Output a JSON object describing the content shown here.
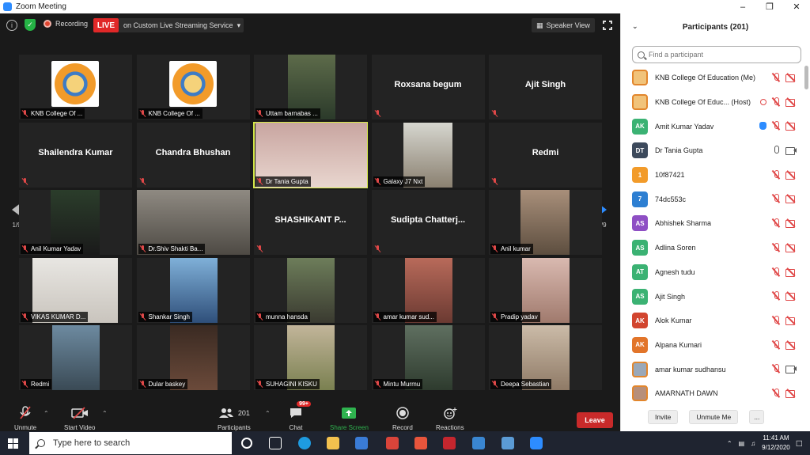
{
  "window": {
    "title": "Zoom Meeting"
  },
  "topbar": {
    "recording_label": "Recording",
    "live_label": "LIVE",
    "stream_label": "on Custom Live Streaming Service",
    "view_label": "Speaker View"
  },
  "grid": {
    "page_left": "1/9",
    "page_right": "1/9",
    "tiles": [
      {
        "name": "KNB College Of ...",
        "kind": "logo"
      },
      {
        "name": "KNB College Of ...",
        "kind": "logo"
      },
      {
        "name": "Uttam barnabas ...",
        "kind": "video"
      },
      {
        "name": "Roxsana begum",
        "kind": "name"
      },
      {
        "name": "Ajit Singh",
        "kind": "name"
      },
      {
        "name": "Shailendra Kumar",
        "kind": "name"
      },
      {
        "name": "Chandra Bhushan",
        "kind": "name"
      },
      {
        "name": "Dr Tania Gupta",
        "kind": "video",
        "active": true
      },
      {
        "name": "Galaxy J7 Nxt",
        "kind": "video"
      },
      {
        "name": "Redmi",
        "kind": "name"
      },
      {
        "name": "Anil Kumar Yadav",
        "kind": "video"
      },
      {
        "name": "Dr.Shiv Shakti Ba...",
        "kind": "video"
      },
      {
        "name": "SHASHIKANT P...",
        "kind": "name"
      },
      {
        "name": "Sudipta Chatterj...",
        "kind": "name"
      },
      {
        "name": "Anil kumar",
        "kind": "video"
      },
      {
        "name": "VIKAS KUMAR D...",
        "kind": "video"
      },
      {
        "name": "Shankar Singh",
        "kind": "video"
      },
      {
        "name": "munna hansda",
        "kind": "video"
      },
      {
        "name": "amar kumar sud...",
        "kind": "video"
      },
      {
        "name": "Pradip yadav",
        "kind": "video"
      },
      {
        "name": "Redmi",
        "kind": "video"
      },
      {
        "name": "Dular baskey",
        "kind": "video"
      },
      {
        "name": "SUHAGINI KISKU",
        "kind": "video"
      },
      {
        "name": "Mintu Murmu",
        "kind": "video"
      },
      {
        "name": "Deepa Sebastian",
        "kind": "video"
      }
    ]
  },
  "toolbar": {
    "unmute": "Unmute",
    "start_video": "Start Video",
    "participants": "Participants",
    "participants_count": "201",
    "chat": "Chat",
    "chat_badge": "99+",
    "share_screen": "Share Screen",
    "record": "Record",
    "reactions": "Reactions",
    "leave": "Leave"
  },
  "panel": {
    "title": "Participants (201)",
    "search_placeholder": "Find a participant",
    "invite": "Invite",
    "unmute_me": "Unmute Me",
    "more": "...",
    "participants": [
      {
        "name": "KNB College Of Education (Me)",
        "initials": "",
        "color": "#f1c37a",
        "icons": [
          "mic-off",
          "vid-off"
        ]
      },
      {
        "name": "KNB College Of Educ... (Host)",
        "initials": "",
        "color": "#f1c37a",
        "icons": [
          "rec",
          "mic-off",
          "vid-off"
        ]
      },
      {
        "name": "Amit Kumar Yadav",
        "initials": "AK",
        "color": "#3bb273",
        "icons": [
          "hand",
          "mic-off",
          "vid-off"
        ]
      },
      {
        "name": "Dr Tania Gupta",
        "initials": "DT",
        "color": "#3d4a5c",
        "icons": [
          "mic",
          "vid"
        ]
      },
      {
        "name": "10f87421",
        "initials": "1",
        "color": "#f29b2a",
        "icons": [
          "mic-off",
          "vid-off"
        ]
      },
      {
        "name": "74dc553c",
        "initials": "7",
        "color": "#2d7fd2",
        "icons": [
          "mic-off",
          "vid-off"
        ]
      },
      {
        "name": "Abhishek Sharma",
        "initials": "AS",
        "color": "#8e4fc4",
        "icons": [
          "mic-off",
          "vid-off"
        ]
      },
      {
        "name": "Adlina Soren",
        "initials": "AS",
        "color": "#3bb273",
        "icons": [
          "mic-off",
          "vid-off"
        ]
      },
      {
        "name": "Agnesh tudu",
        "initials": "AT",
        "color": "#3bb273",
        "icons": [
          "mic-off",
          "vid-off"
        ]
      },
      {
        "name": "Ajit Singh",
        "initials": "AS",
        "color": "#3bb273",
        "icons": [
          "mic-off",
          "vid-off"
        ]
      },
      {
        "name": "Alok Kumar",
        "initials": "AK",
        "color": "#d2452f",
        "icons": [
          "mic-off",
          "vid-off"
        ]
      },
      {
        "name": "Alpana Kumari",
        "initials": "AK",
        "color": "#e2752a",
        "icons": [
          "mic-off",
          "vid-off"
        ]
      },
      {
        "name": "amar kumar sudhansu",
        "initials": "",
        "color": "#9aa8b8",
        "icons": [
          "mic-off",
          "vid"
        ]
      },
      {
        "name": "AMARNATH DAWN",
        "initials": "",
        "color": "#b78f7a",
        "icons": [
          "mic-off",
          "vid-off"
        ]
      }
    ]
  },
  "taskbar": {
    "search_placeholder": "Type here to search",
    "time": "11:41 AM",
    "date": "9/12/2020"
  }
}
